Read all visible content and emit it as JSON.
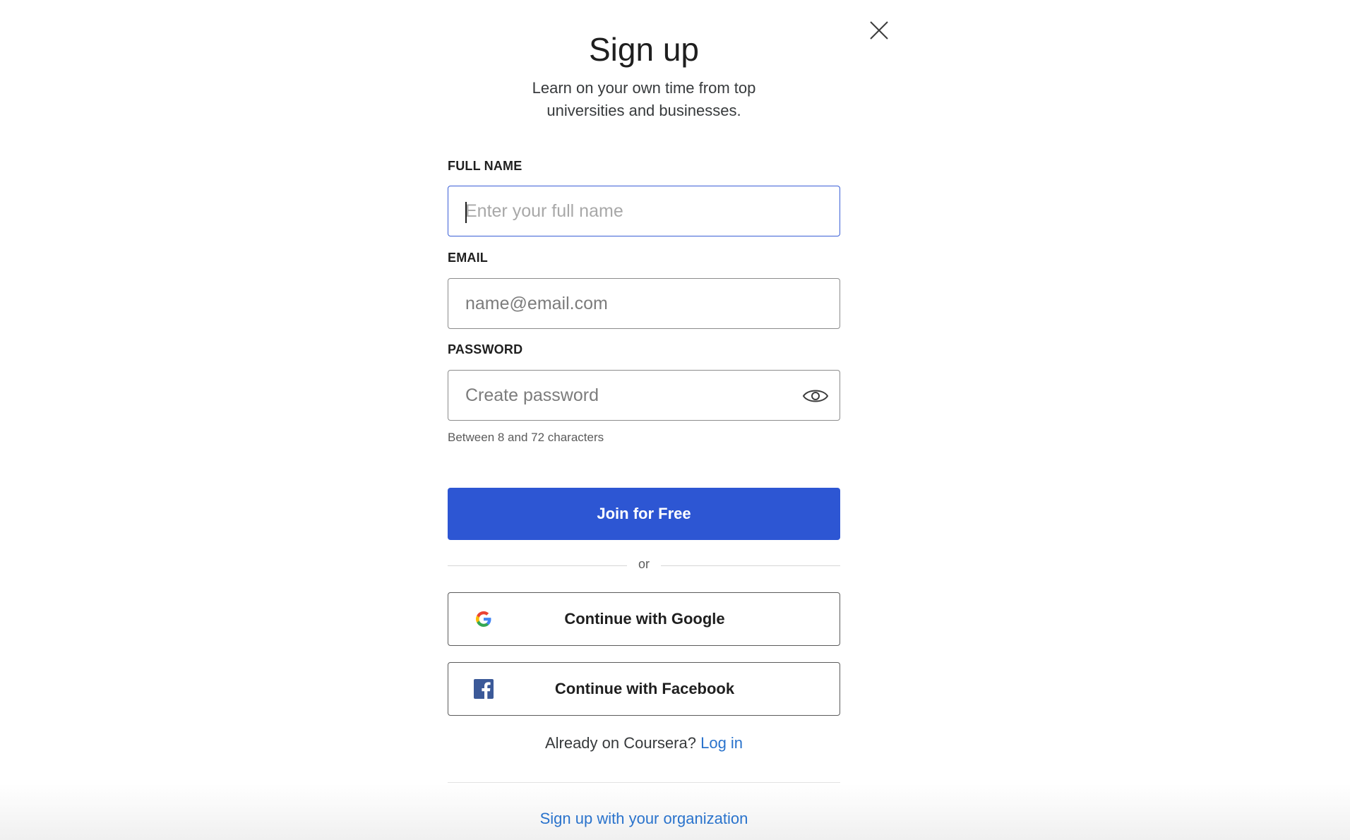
{
  "dialog": {
    "title": "Sign up",
    "subtitle": "Learn on your own time from top universities and businesses."
  },
  "form": {
    "full_name": {
      "label": "FULL NAME",
      "placeholder": "Enter your full name",
      "value": ""
    },
    "email": {
      "label": "EMAIL",
      "placeholder": "name@email.com",
      "value": ""
    },
    "password": {
      "label": "PASSWORD",
      "placeholder": "Create password",
      "value": "",
      "hint": "Between 8 and 72 characters"
    },
    "submit_label": "Join for Free"
  },
  "divider_text": "or",
  "social": {
    "google_label": "Continue with Google",
    "facebook_label": "Continue with Facebook"
  },
  "login": {
    "prompt": "Already on Coursera?",
    "link_label": "Log in"
  },
  "organization_link": "Sign up with your organization",
  "colors": {
    "primary_button": "#2d56d3",
    "link": "#2a73cc",
    "focus_border": "#3a5fd6",
    "facebook": "#3b5998"
  },
  "icons": [
    "close-icon",
    "eye-icon",
    "google-icon",
    "facebook-icon"
  ]
}
